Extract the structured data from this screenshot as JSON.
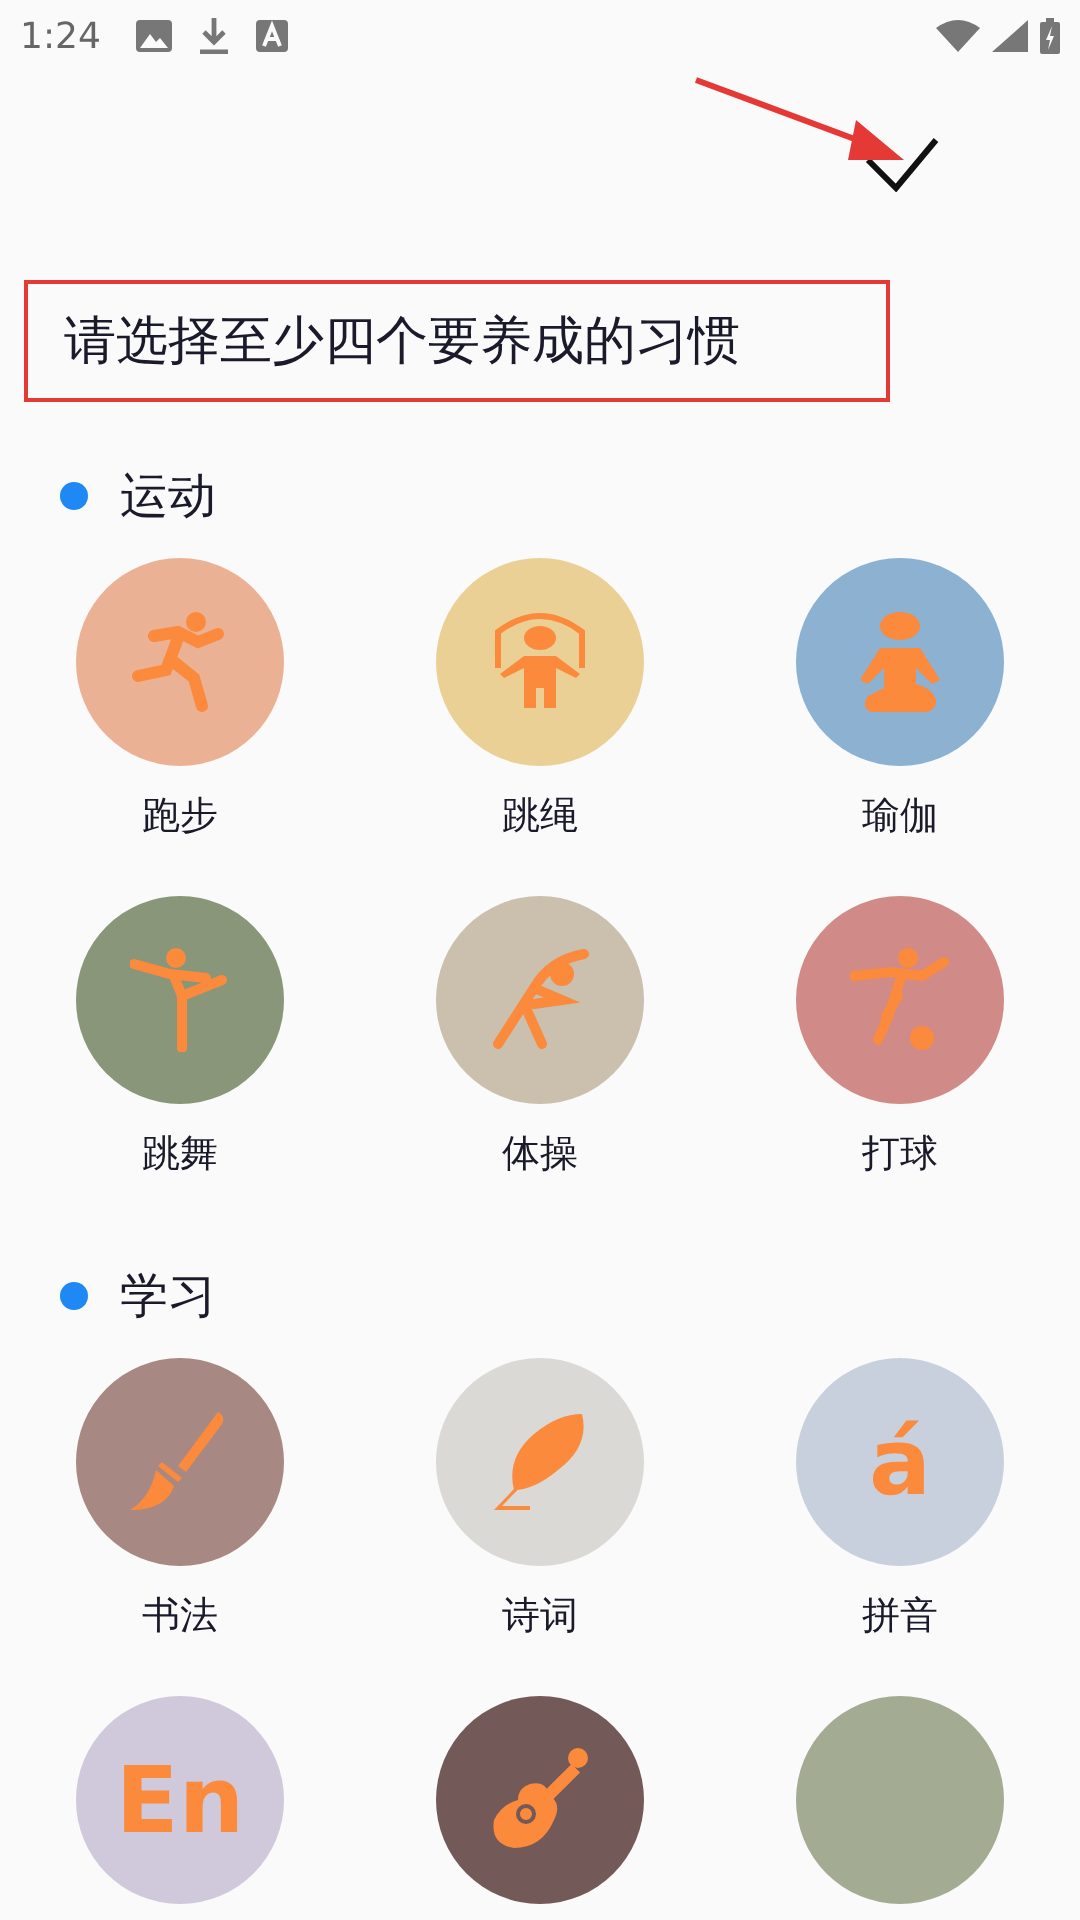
{
  "status_bar": {
    "time": "1:24"
  },
  "annotations": {
    "title_highlighted": true,
    "arrow_to_confirm": true
  },
  "title": "请选择至少四个要养成的习惯",
  "sections": [
    {
      "label": "运动",
      "items": [
        {
          "label": "跑步",
          "color": "#ebb195",
          "kind": "run"
        },
        {
          "label": "跳绳",
          "color": "#ebd096",
          "kind": "rope"
        },
        {
          "label": "瑜伽",
          "color": "#8cb1d1",
          "kind": "yoga"
        },
        {
          "label": "跳舞",
          "color": "#8a967a",
          "kind": "dance"
        },
        {
          "label": "体操",
          "color": "#cbbfae",
          "kind": "stretch"
        },
        {
          "label": "打球",
          "color": "#d08a87",
          "kind": "ball"
        }
      ]
    },
    {
      "label": "学习",
      "items": [
        {
          "label": "书法",
          "color": "#a88883",
          "kind": "brush"
        },
        {
          "label": "诗词",
          "color": "#dad9d5",
          "kind": "feather"
        },
        {
          "label": "拼音",
          "color": "#c9d0dd",
          "kind": "glyph",
          "glyph": "á"
        },
        {
          "color": "#d0c8db",
          "kind": "glyph",
          "glyph": "En"
        },
        {
          "color": "#735a59",
          "kind": "guitar"
        },
        {
          "color": "#a3ab93",
          "kind": "hidden"
        }
      ]
    }
  ]
}
